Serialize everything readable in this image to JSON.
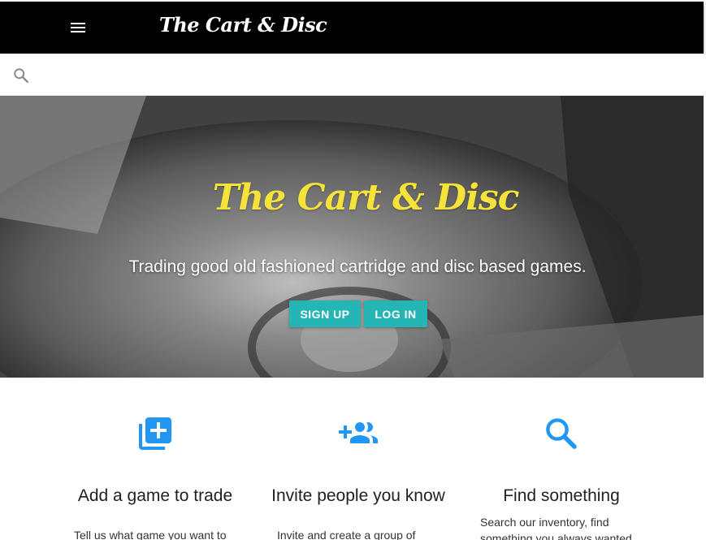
{
  "header": {
    "brand": "The Cart & Disc",
    "menu_icon": "menu-icon"
  },
  "search": {
    "icon": "search-icon",
    "placeholder": "",
    "value": ""
  },
  "hero": {
    "title": "The Cart & Disc",
    "tagline": "Trading good old fashioned cartridge and disc based games.",
    "signup_label": "SIGN UP",
    "login_label": "LOG IN"
  },
  "colors": {
    "appbar": "#000000",
    "hero_title": "#f5e23a",
    "button": "#26b5b5",
    "feature_icon": "#2196f3"
  },
  "features": [
    {
      "icon": "add-to-library-icon",
      "title": "Add a game to trade",
      "desc": "Tell us what game you want to"
    },
    {
      "icon": "group-add-icon",
      "title": "Invite people you know",
      "desc": "Invite and create a group of"
    },
    {
      "icon": "search-icon",
      "title": "Find something",
      "desc": "Search our inventory, find something you always wanted"
    }
  ]
}
